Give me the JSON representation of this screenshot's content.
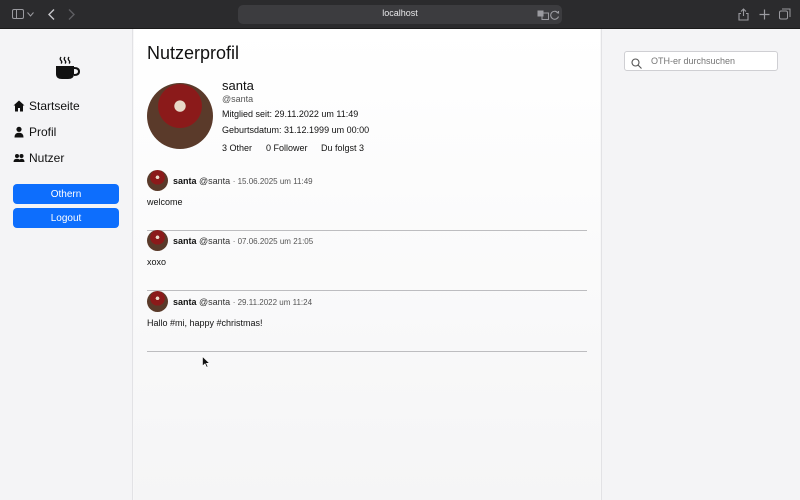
{
  "browser": {
    "url": "localhost",
    "icons": [
      "sidebar-toggle-icon",
      "chevron-down-icon",
      "back-icon",
      "forward-icon",
      "translate-icon",
      "reload-icon",
      "share-icon",
      "new-tab-icon",
      "tabs-overview-icon"
    ]
  },
  "sidebar": {
    "items": [
      {
        "label": "Startseite",
        "icon": "home-icon"
      },
      {
        "label": "Profil",
        "icon": "person-icon"
      },
      {
        "label": "Nutzer",
        "icon": "people-icon"
      }
    ],
    "othern_label": "Othern",
    "logout_label": "Logout"
  },
  "profile": {
    "page_title": "Nutzerprofil",
    "name": "santa",
    "handle": "@santa",
    "member_since": "Mitglied seit: 29.11.2022 um 11:49",
    "birthday": "Geburtsdatum: 31.12.1999 um 00:00",
    "others": "3 Other",
    "followers": "0 Follower",
    "following": "Du folgst 3"
  },
  "posts": [
    {
      "name": "santa",
      "handle": "@santa",
      "meta": "· 15.06.2025 um 11:49",
      "text": "welcome"
    },
    {
      "name": "santa",
      "handle": "@santa",
      "meta": "· 07.06.2025 um 21:05",
      "text": "xoxo"
    },
    {
      "name": "santa",
      "handle": "@santa",
      "meta": "· 29.11.2022 um 11:24",
      "text": "Hallo #mi, happy #christmas!"
    }
  ],
  "search": {
    "placeholder": "OTH-er durchsuchen"
  },
  "colors": {
    "accent": "#0d6efd",
    "chrome": "#2b2b2d"
  }
}
